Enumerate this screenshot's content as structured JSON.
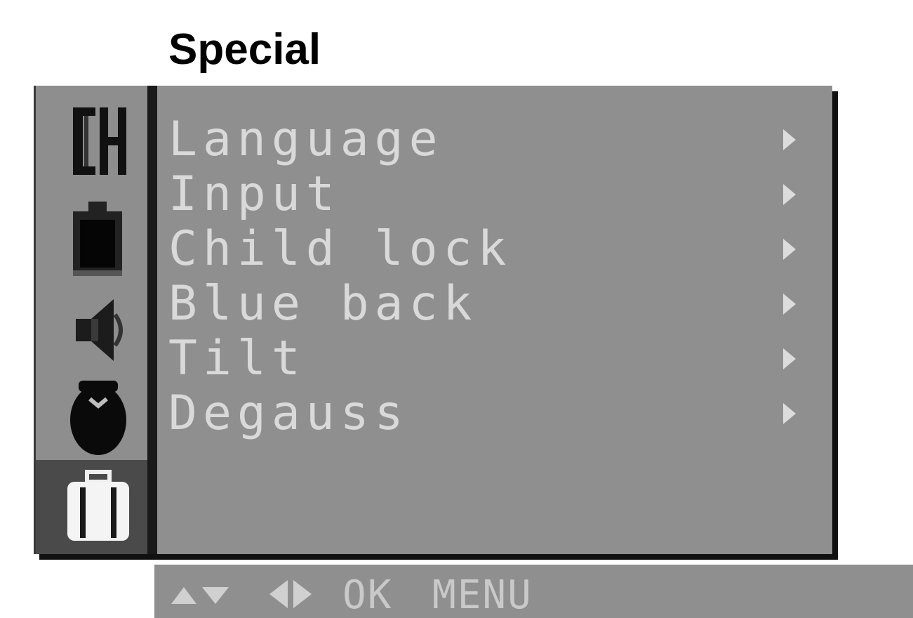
{
  "title": "Special",
  "sidebar": {
    "icons": [
      {
        "name": "channel-icon",
        "label": "CH"
      },
      {
        "name": "picture-icon"
      },
      {
        "name": "sound-icon"
      },
      {
        "name": "time-icon"
      },
      {
        "name": "special-icon",
        "selected": true
      }
    ]
  },
  "menu": {
    "items": [
      {
        "label": "Language"
      },
      {
        "label": "Input"
      },
      {
        "label": "Child lock"
      },
      {
        "label": "Blue back"
      },
      {
        "label": "Tilt"
      },
      {
        "label": "Degauss"
      }
    ]
  },
  "hint_bar": {
    "nav_icon": "up-down-arrows-icon",
    "adjust_icon": "left-right-arrows-icon",
    "ok_label": "OK",
    "menu_label": "MENU"
  },
  "colors": {
    "panel": "#8f8f8f",
    "text": "#d9d9d9",
    "selected_icon_bg": "#4a4a4a"
  }
}
